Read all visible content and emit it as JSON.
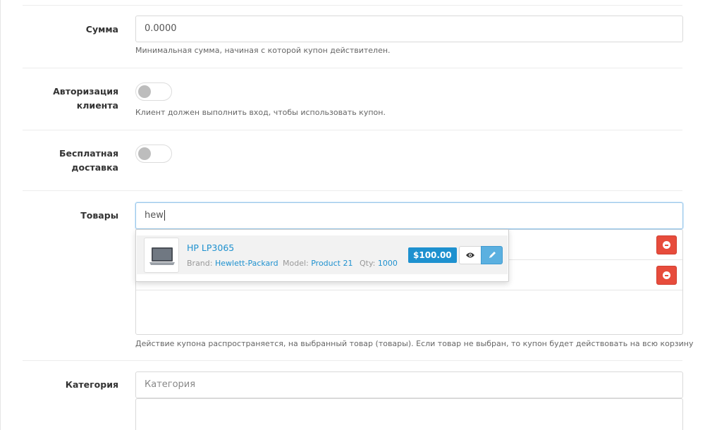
{
  "fields": {
    "total": {
      "label": "Сумма",
      "value": "0.0000",
      "help": "Минимальная сумма, начиная с которой купон действителен."
    },
    "logged": {
      "label_line1": "Авторизация",
      "label_line2": "клиента",
      "enabled": false,
      "help": "Клиент должен выполнить вход, чтобы использовать купон."
    },
    "shipping": {
      "label_line1": "Бесплатная",
      "label_line2": "доставка",
      "enabled": false
    },
    "products": {
      "label": "Товары",
      "value": "hew",
      "help": "Действие купона распространяется, на выбранный товар (товары). Если товар не выбран, то купон будет действовать на всю корзину"
    },
    "category": {
      "label": "Категория",
      "placeholder": "Категория"
    }
  },
  "autocomplete": {
    "name": "HP LP3065",
    "brand_label": "Brand:",
    "brand": "Hewlett-Packard",
    "model_label": "Model:",
    "model": "Product 21",
    "qty_label": "Qty:",
    "qty": "1000",
    "price": "$100.00",
    "icons": {
      "view": "eye-icon",
      "edit": "pencil-icon",
      "remove": "minus-circle-icon"
    }
  },
  "colors": {
    "accent": "#1e91cf",
    "danger": "#e74c3c",
    "edit": "#5bb0e0"
  }
}
